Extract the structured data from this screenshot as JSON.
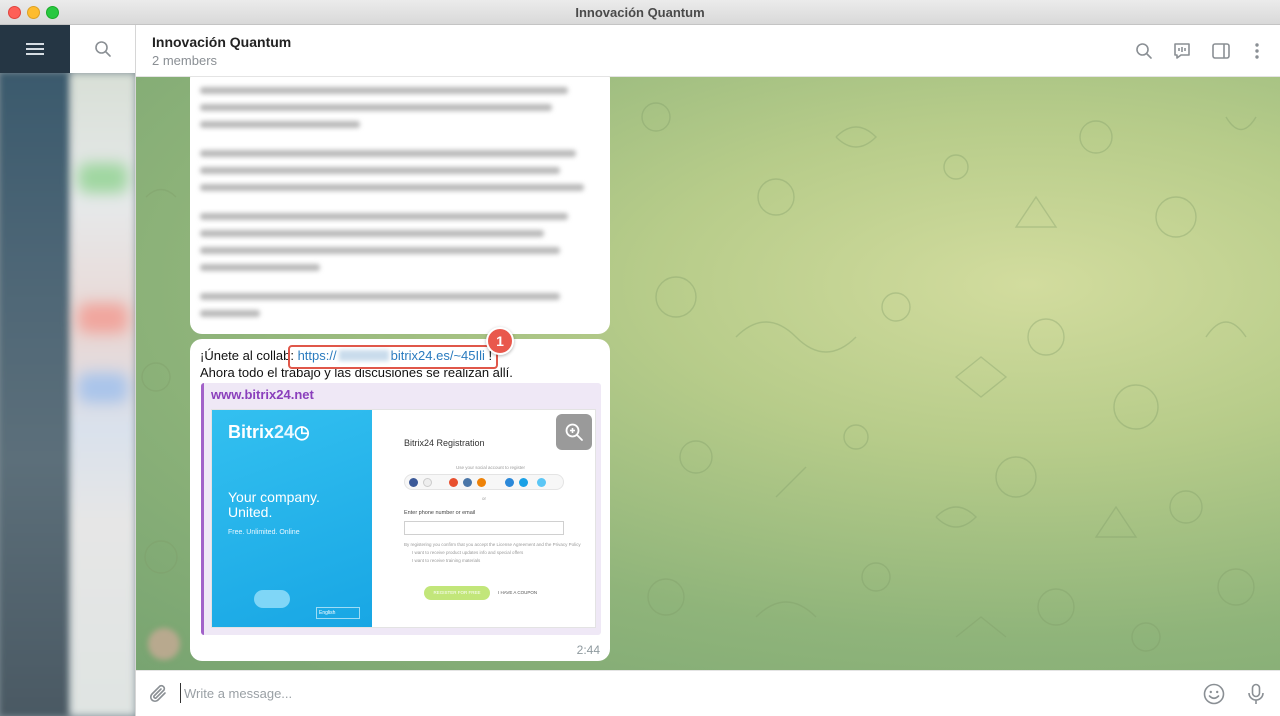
{
  "window": {
    "title": "Innovación Quantum"
  },
  "header": {
    "chat_title": "Innovación Quantum",
    "members": "2 members"
  },
  "message": {
    "prefix": "¡Únete al collab:",
    "link_start": "https://",
    "link_end": "bitrix24.es/~45Ili",
    "suffix": " !",
    "line2": "Ahora todo el trabajo y las discusiones se realizan allí.",
    "badge_number": "1",
    "time": "2:44"
  },
  "preview": {
    "site": "www.bitrix24.net",
    "logo": "Bitrix",
    "logo_num": "24",
    "tagline_1": "Your company.",
    "tagline_2": "United.",
    "tagline_small": "Free. Unlimited. Online",
    "reg_title": "Bitrix24 Registration",
    "social_hint": "Use your social account to register",
    "or": "or",
    "phone_label": "Enter phone number or email",
    "terms": "By registering you confirm that you accept the License Agreement and the Privacy Policy",
    "check1": "I want to receive product updates info and special offers",
    "check2": "I want to receive training materials",
    "register_btn": "REGISTER FOR FREE",
    "coupon": "I HAVE A COUPON",
    "lang": "English"
  },
  "input": {
    "placeholder": "Write a message..."
  },
  "colors": {
    "accent_red": "#e9584c",
    "link": "#2a7bbf",
    "preview_bar": "#a262c9",
    "sidebar_dark": "#253644"
  }
}
